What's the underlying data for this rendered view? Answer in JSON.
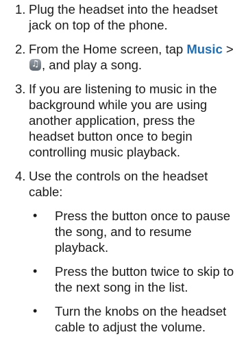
{
  "steps": [
    {
      "num": "1.",
      "text": "Plug the headset into the headset jack on top of the phone."
    },
    {
      "num": "2.",
      "pre": "From the Home screen, tap ",
      "bold": "Music",
      "mid": " > ",
      "icon": "music-player-icon",
      "post": ", and play a song."
    },
    {
      "num": "3.",
      "text": "If you are listening to music in the background while you are using another application, press the headset button once to begin controlling music playback."
    },
    {
      "num": "4.",
      "text": "Use the controls on the headset cable:"
    }
  ],
  "sub_items": [
    {
      "bullet": "•",
      "text": "Press the button once to pause the song, and to resume playback."
    },
    {
      "bullet": "•",
      "text": "Press the button twice to skip to the next song in the list."
    },
    {
      "bullet": "•",
      "text": "Turn the knobs on the headset cable to adjust the volume."
    }
  ],
  "colors": {
    "accent": "#1f6fb6",
    "text": "#1a1a1a"
  }
}
